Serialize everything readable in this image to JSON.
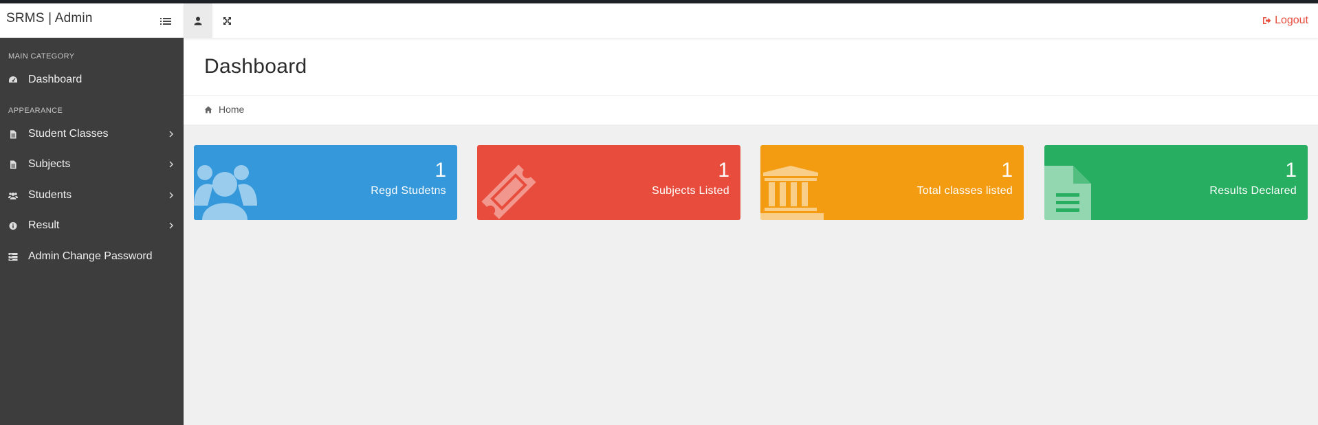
{
  "brand": {
    "title": "SRMS | Admin",
    "toggle_icon": "menu-lines-icon"
  },
  "topbar": {
    "user_icon": "user-icon",
    "expand_icon": "expand-arrows-icon",
    "logout_label": "Logout",
    "logout_icon": "sign-out-icon",
    "logout_color": "#e74c3c"
  },
  "sidebar": {
    "categories": [
      "MAIN CATEGORY",
      "APPEARANCE"
    ],
    "items": [
      {
        "label": "Dashboard",
        "icon": "dashboard-gauge-icon",
        "has_submenu": false
      },
      {
        "label": "Student Classes",
        "icon": "file-text-icon",
        "has_submenu": true
      },
      {
        "label": "Subjects",
        "icon": "file-text-icon",
        "has_submenu": true
      },
      {
        "label": "Students",
        "icon": "users-icon",
        "has_submenu": true
      },
      {
        "label": "Result",
        "icon": "info-circle-icon",
        "has_submenu": true
      },
      {
        "label": "Admin Change Password",
        "icon": "server-icon",
        "has_submenu": false
      }
    ]
  },
  "page": {
    "title": "Dashboard",
    "breadcrumb": "Home",
    "breadcrumb_icon": "home-icon"
  },
  "stats": [
    {
      "value": "1",
      "label": "Regd Studetns",
      "icon": "users-icon",
      "color": "#3498db"
    },
    {
      "value": "1",
      "label": "Subjects Listed",
      "icon": "ticket-icon",
      "color": "#e74c3c"
    },
    {
      "value": "1",
      "label": "Total classes listed",
      "icon": "bank-icon",
      "color": "#f39c12"
    },
    {
      "value": "1",
      "label": "Results Declared",
      "icon": "file-text-icon",
      "color": "#27ae60"
    }
  ]
}
